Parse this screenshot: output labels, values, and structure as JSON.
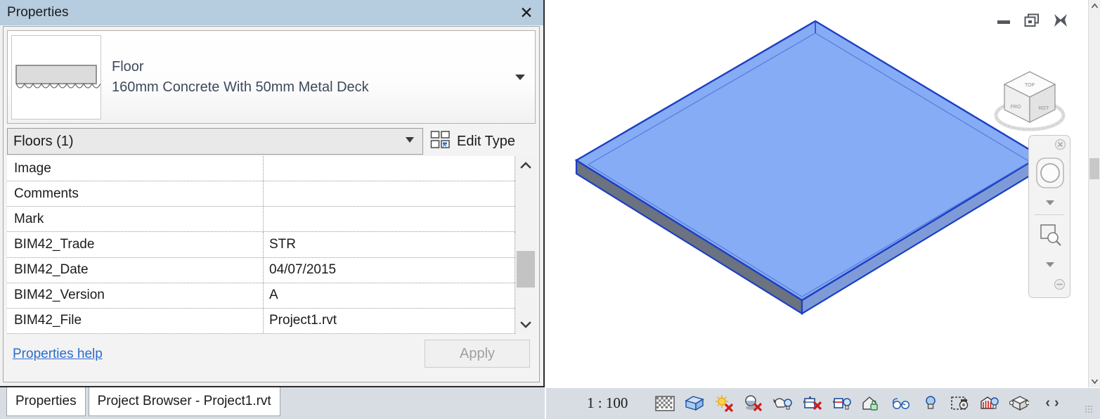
{
  "properties_palette": {
    "title": "Properties",
    "close_icon": "close-icon",
    "type_selector": {
      "family": "Floor",
      "type_name": "160mm Concrete With 50mm Metal Deck",
      "thumbnail_icon": "metal-deck-floor-preview",
      "dropdown_icon": "chevron-down-icon"
    },
    "category_selector": {
      "value": "Floors (1)",
      "dropdown_icon": "chevron-down-icon"
    },
    "edit_type": {
      "label": "Edit Type",
      "icon": "edit-type-icon"
    },
    "grid": {
      "rows": [
        {
          "name": "Image",
          "value": ""
        },
        {
          "name": "Comments",
          "value": ""
        },
        {
          "name": "Mark",
          "value": ""
        },
        {
          "name": "BIM42_Trade",
          "value": "STR"
        },
        {
          "name": "BIM42_Date",
          "value": "04/07/2015"
        },
        {
          "name": "BIM42_Version",
          "value": "A"
        },
        {
          "name": "BIM42_File",
          "value": "Project1.rvt"
        }
      ],
      "scroll_up_icon": "chevron-up-icon",
      "scroll_down_icon": "chevron-down-icon"
    },
    "footer": {
      "help_link": "Properties help",
      "apply_button": "Apply"
    },
    "tabs": [
      {
        "label": "Properties",
        "active": true
      },
      {
        "label": "Project Browser - Project1.rvt",
        "active": false
      }
    ]
  },
  "view_window": {
    "window_controls": {
      "minimize_icon": "minimize-icon",
      "restore_icon": "restore-icon",
      "close_icon": "close-icon"
    },
    "viewcube": {
      "icon": "viewcube-icon",
      "face_top": "TOP",
      "face_front": "FRONT",
      "face_right": "RIGHT"
    },
    "navigation_bar": {
      "close_icon": "nav-close-icon",
      "steering_wheel_icon": "steering-wheel-icon",
      "wheel_dropdown_icon": "chevron-down-icon",
      "zoom_region_icon": "zoom-region-icon",
      "zoom_dropdown_icon": "chevron-down-icon",
      "minimize_icon": "nav-minimize-icon"
    },
    "model": {
      "element": "floor-slab",
      "top_face_color": "#86acf6",
      "right_face_color": "#7e9bd8",
      "left_face_color": "#6b7280",
      "edge_color": "#1c3fc4"
    },
    "scrollbar": {
      "up_icon": "chevron-up-icon",
      "down_icon": "chevron-down-icon"
    }
  },
  "view_control_bar": {
    "scale": "1 : 100",
    "icons": [
      {
        "name": "detail-level-icon",
        "title": "Detail Level"
      },
      {
        "name": "visual-style-icon",
        "title": "Visual Style"
      },
      {
        "name": "sun-path-off-icon",
        "title": "Sun Path Off"
      },
      {
        "name": "shadows-off-icon",
        "title": "Shadows Off"
      },
      {
        "name": "rendering-dialog-icon",
        "title": "Show Rendering Dialog"
      },
      {
        "name": "crop-view-off-icon",
        "title": "Crop View"
      },
      {
        "name": "show-crop-region-icon",
        "title": "Show Crop Region"
      },
      {
        "name": "temporary-hide-isolate-icon",
        "title": "Temporary Hide/Isolate"
      },
      {
        "name": "reveal-hidden-elements-icon",
        "title": "Reveal Hidden Elements"
      },
      {
        "name": "worksharing-display-icon",
        "title": "Worksharing Display"
      },
      {
        "name": "temporary-view-properties-icon",
        "title": "Temporary View Properties"
      },
      {
        "name": "analytical-model-icon",
        "title": "Show Analytical Model"
      },
      {
        "name": "constraints-icon",
        "title": "Reveal Constraints"
      }
    ],
    "prev_arrow": "‹",
    "next_arrow": "›",
    "grip_icon": "resize-grip-icon"
  }
}
